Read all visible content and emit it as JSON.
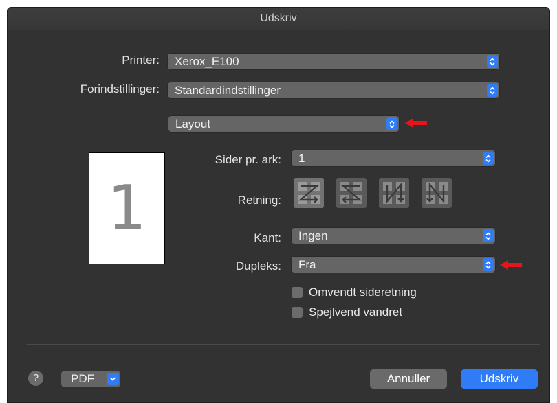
{
  "window": {
    "title": "Udskriv"
  },
  "printer": {
    "label": "Printer:",
    "value": "Xerox_E100"
  },
  "presets": {
    "label": "Forindstillinger:",
    "value": "Standardindstillinger"
  },
  "section": {
    "value": "Layout"
  },
  "preview": {
    "page_number": "1"
  },
  "pages_per_sheet": {
    "label": "Sider pr. ark:",
    "value": "1"
  },
  "orientation": {
    "label": "Retning:",
    "options": [
      "layout-direction-z-icon",
      "layout-direction-s-icon",
      "layout-direction-n-icon",
      "layout-direction-reverse-n-icon"
    ]
  },
  "border": {
    "label": "Kant:",
    "value": "Ingen"
  },
  "duplex": {
    "label": "Dupleks:",
    "value": "Fra"
  },
  "checkboxes": {
    "reverse_orientation": "Omvendt sideretning",
    "flip_horizontal": "Spejlvend vandret"
  },
  "footer": {
    "help": "?",
    "pdf": "PDF",
    "cancel": "Annuller",
    "print": "Udskriv"
  },
  "colors": {
    "accent": "#2f7cf6",
    "annotation_arrow": "#e8141b",
    "window_bg": "#323232"
  }
}
